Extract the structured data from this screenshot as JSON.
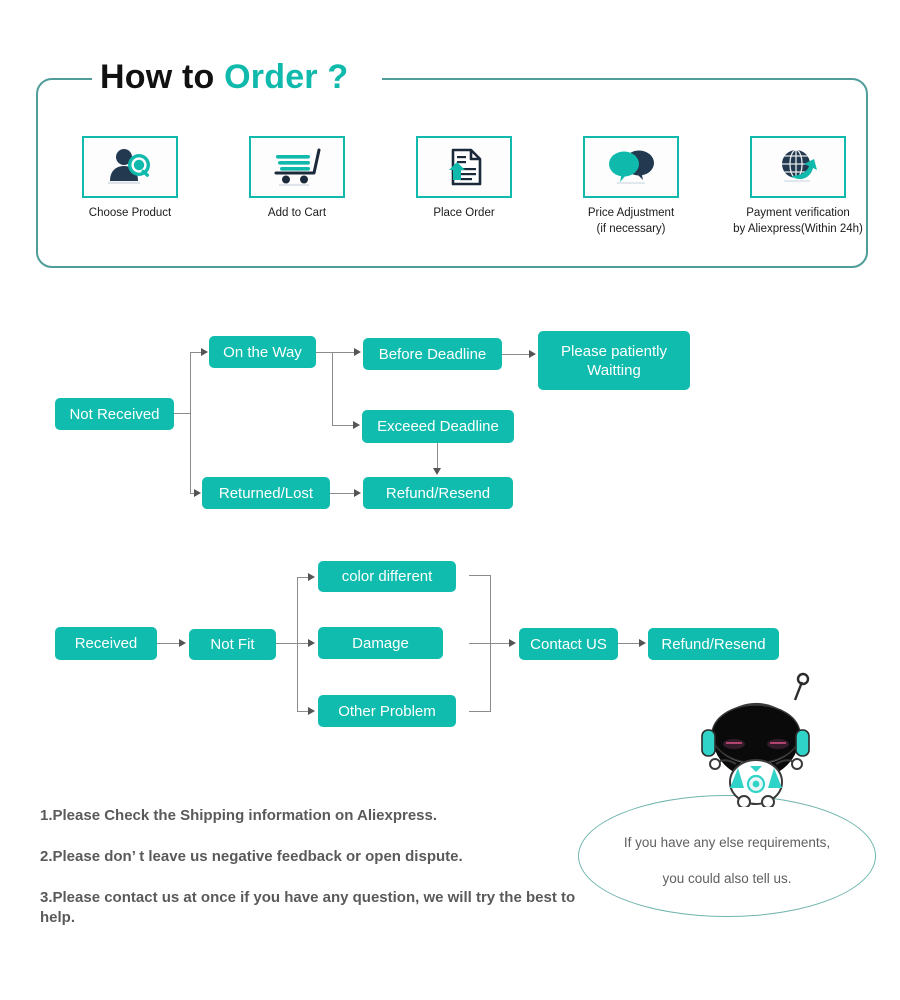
{
  "header": {
    "title_part1": "How to ",
    "title_part2": "Order ?",
    "accent_color": "#0fb9ab",
    "frame_color": "#4f9c99"
  },
  "steps": [
    {
      "icon": "person-search-icon",
      "label": "Choose  Product"
    },
    {
      "icon": "shopping-cart-icon",
      "label": "Add to Cart"
    },
    {
      "icon": "document-upload-icon",
      "label": "Place  Order"
    },
    {
      "icon": "speech-bubbles-icon",
      "label": "Price Adjustment\n(if necessary)"
    },
    {
      "icon": "globe-arrow-icon",
      "label": "Payment verification\nby Aliexpress(Within 24h)"
    }
  ],
  "flow_not_received": {
    "nodes": {
      "start": "Not Received",
      "on_the_way": "On the Way",
      "returned_lost": "Returned/Lost",
      "before_deadline": "Before Deadline",
      "exceed_deadline": "Exceeed Deadline",
      "refund_resend": "Refund/Resend",
      "please_wait": "Please patiently Waitting"
    }
  },
  "flow_received": {
    "nodes": {
      "start": "Received",
      "not_fit": "Not Fit",
      "color_different": "color different",
      "damage": "Damage",
      "other_problem": "Other Problem",
      "contact_us": "Contact US",
      "refund_resend": "Refund/Resend"
    }
  },
  "notes": [
    "1.Please Check the Shipping information on Aliexpress.",
    "2.Please don’ t leave us negative feedback or open dispute.",
    "3.Please contact us at once if you have any question, we will try  the best to help."
  ],
  "mascot": {
    "bubble_line1": "If you have any else requirements,",
    "bubble_line2": "you could also tell us."
  },
  "colors": {
    "node_teal": "#0fbcae",
    "connector_gray": "#8b8b8b",
    "note_gray": "#5a5a5a"
  }
}
